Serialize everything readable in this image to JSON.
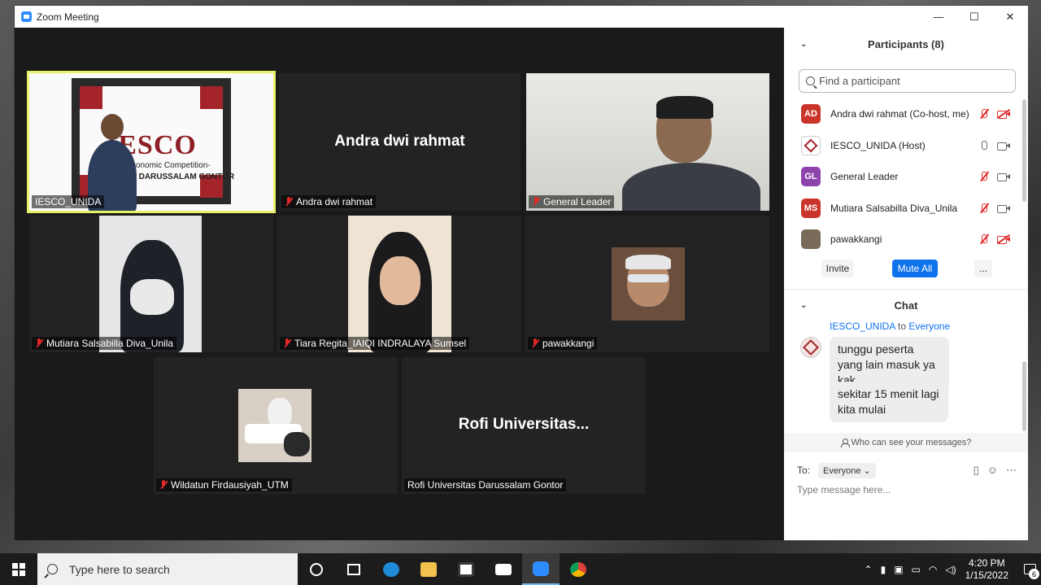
{
  "window": {
    "title": "Zoom Meeting",
    "controls": [
      "—",
      "☐",
      "✕"
    ]
  },
  "tiles": [
    {
      "name": "IESCO_UNIDA",
      "active": true,
      "muted": false,
      "banner": {
        "logo": "IESCO",
        "line1": "-Islamic Economic Competition-",
        "line2": "UNIVERSITY DARUSSALAM GONTOR"
      }
    },
    {
      "name": "Andra dwi rahmat",
      "display_name": "Andra dwi rahmat",
      "muted": true
    },
    {
      "name": "General Leader",
      "muted": true
    },
    {
      "name": "Mutiara Salsabilla Diva_Unila",
      "muted": true
    },
    {
      "name": "Tiara Regita_IAIQI INDRALAYA Sumsel",
      "muted": true
    },
    {
      "name": "pawakkangi",
      "muted": true
    },
    {
      "name": "Wildatun Firdausiyah_UTM",
      "muted": true
    },
    {
      "name": "Rofi Universitas Darussalam Gontor",
      "display_name": "Rofi  Universitas...",
      "muted": false
    }
  ],
  "participants": {
    "header": "Participants (8)",
    "search_placeholder": "Find a participant",
    "list": [
      {
        "initials": "AD",
        "avatar_color": "#c9352b",
        "name": "Andra dwi rahmat (Co-host, me)",
        "mic": "off",
        "cam": "off"
      },
      {
        "initials": "",
        "avatar_color": "#ffffff",
        "name": "IESCO_UNIDA (Host)",
        "mic": "on",
        "cam": "on"
      },
      {
        "initials": "GL",
        "avatar_color": "#8e44ad",
        "name": "General Leader",
        "mic": "off",
        "cam": "on"
      },
      {
        "initials": "MS",
        "avatar_color": "#c9352b",
        "name": "Mutiara Salsabilla Diva_Unila",
        "mic": "off",
        "cam": "on"
      },
      {
        "initials": "",
        "avatar_color": "#7a6a5a",
        "name": "pawakkangi",
        "mic": "off",
        "cam": "off"
      }
    ],
    "buttons": {
      "invite": "Invite",
      "mute_all": "Mute All",
      "more": "..."
    }
  },
  "chat": {
    "header": "Chat",
    "from": "IESCO_UNIDA",
    "to_word": "to",
    "to_target": "Everyone",
    "messages": [
      "tunggu peserta yang lain masuk ya kak",
      "sekitar 15 menit lagi kita mulai"
    ],
    "who_can_see": "Who can see your messages?",
    "to_label": "To:",
    "to_select": "Everyone",
    "input_placeholder": "Type message here..."
  },
  "taskbar": {
    "search_placeholder": "Type here to search",
    "time": "4:20 PM",
    "date": "1/15/2022",
    "notification_count": "6"
  }
}
